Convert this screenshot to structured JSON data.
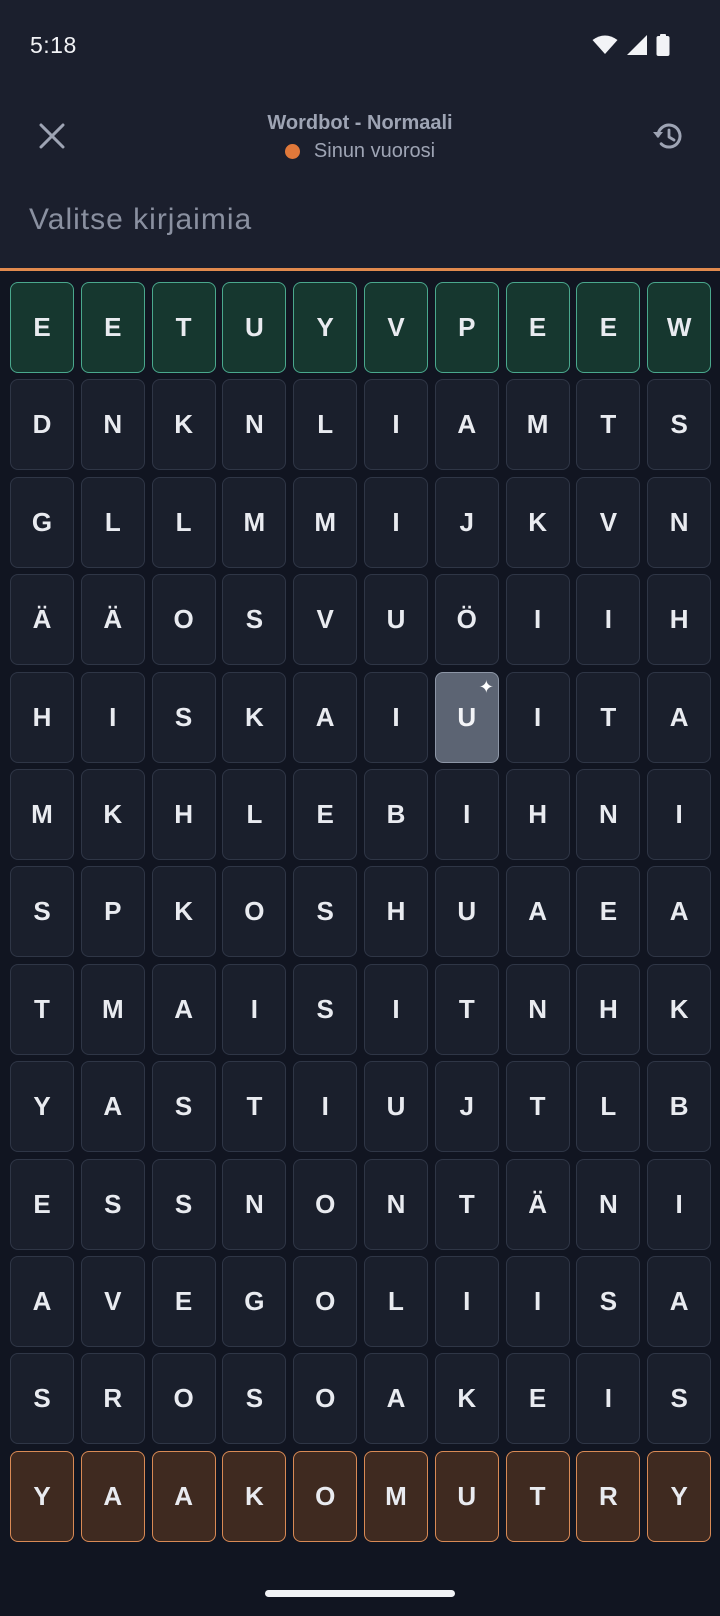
{
  "status_bar": {
    "time": "5:18",
    "icons": [
      "wifi-icon",
      "cell-signal-icon",
      "battery-icon"
    ]
  },
  "header": {
    "close_icon": "close-icon",
    "title": "Wordbot - Normaali",
    "turn_text": "Sinun vuorosi",
    "turn_dot_color": "#e0783a",
    "history_icon": "history-icon"
  },
  "selection": {
    "placeholder": "Valitse kirjaimia"
  },
  "colors": {
    "background": "#111521",
    "header_bg": "#1b1f2d",
    "divider": "#e28a4e",
    "top_row_fill": "#16372f",
    "top_row_border": "#4aa88d",
    "bottom_row_fill": "#3f2a20",
    "bottom_row_border": "#d98a55",
    "selected_tile": "#5c6473"
  },
  "board": {
    "special_tile": {
      "row": 4,
      "col": 6,
      "icon": "sparkle-icon",
      "glyph": "✦"
    },
    "rows": [
      [
        "E",
        "E",
        "T",
        "U",
        "Y",
        "V",
        "P",
        "E",
        "E",
        "W"
      ],
      [
        "D",
        "N",
        "K",
        "N",
        "L",
        "I",
        "A",
        "M",
        "T",
        "S"
      ],
      [
        "G",
        "L",
        "L",
        "M",
        "M",
        "I",
        "J",
        "K",
        "V",
        "N"
      ],
      [
        "Ä",
        "Ä",
        "O",
        "S",
        "V",
        "U",
        "Ö",
        "I",
        "I",
        "H"
      ],
      [
        "H",
        "I",
        "S",
        "K",
        "A",
        "I",
        "U",
        "I",
        "T",
        "A"
      ],
      [
        "M",
        "K",
        "H",
        "L",
        "E",
        "B",
        "I",
        "H",
        "N",
        "I"
      ],
      [
        "S",
        "P",
        "K",
        "O",
        "S",
        "H",
        "U",
        "A",
        "E",
        "A"
      ],
      [
        "T",
        "M",
        "A",
        "I",
        "S",
        "I",
        "T",
        "N",
        "H",
        "K"
      ],
      [
        "Y",
        "A",
        "S",
        "T",
        "I",
        "U",
        "J",
        "T",
        "L",
        "B"
      ],
      [
        "E",
        "S",
        "S",
        "N",
        "O",
        "N",
        "T",
        "Ä",
        "N",
        "I"
      ],
      [
        "A",
        "V",
        "E",
        "G",
        "O",
        "L",
        "I",
        "I",
        "S",
        "A"
      ],
      [
        "S",
        "R",
        "O",
        "S",
        "O",
        "A",
        "K",
        "E",
        "I",
        "S"
      ],
      [
        "Y",
        "A",
        "A",
        "K",
        "O",
        "M",
        "U",
        "T",
        "R",
        "Y"
      ]
    ]
  }
}
